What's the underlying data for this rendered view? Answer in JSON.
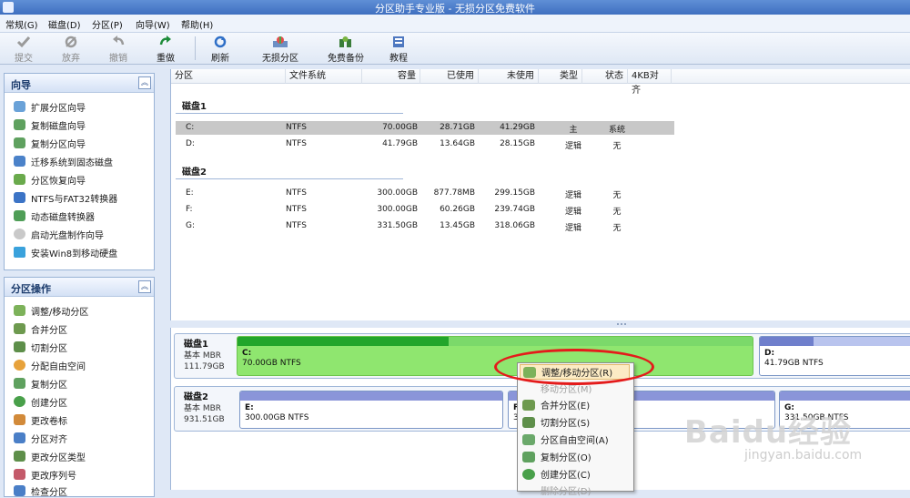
{
  "window": {
    "title": "分区助手专业版 - 无损分区免费软件"
  },
  "menu": [
    "常规(G)",
    "磁盘(D)",
    "分区(P)",
    "向导(W)",
    "帮助(H)"
  ],
  "toolbar": {
    "buttons": [
      {
        "label": "提交",
        "icon": "check-icon",
        "disabled": true
      },
      {
        "label": "放弃",
        "icon": "discard-icon",
        "disabled": true
      },
      {
        "label": "撤销",
        "icon": "undo-icon",
        "disabled": true
      },
      {
        "label": "重做",
        "icon": "redo-icon",
        "disabled": false
      },
      {
        "label": "刷新",
        "icon": "refresh-icon",
        "disabled": false
      },
      {
        "label": "无损分区",
        "icon": "partition-icon",
        "disabled": false
      },
      {
        "label": "免费备份",
        "icon": "backup-icon",
        "disabled": false
      },
      {
        "label": "教程",
        "icon": "tutorial-icon",
        "disabled": false
      }
    ]
  },
  "wizard_panel": {
    "title": "向导",
    "items": [
      "扩展分区向导",
      "复制磁盘向导",
      "复制分区向导",
      "迁移系统到固态磁盘",
      "分区恢复向导",
      "NTFS与FAT32转换器",
      "动态磁盘转换器",
      "启动光盘制作向导",
      "安装Win8到移动硬盘"
    ]
  },
  "ops_panel": {
    "title": "分区操作",
    "items": [
      "调整/移动分区",
      "合并分区",
      "切割分区",
      "分配自由空间",
      "复制分区",
      "创建分区",
      "更改卷标",
      "分区对齐",
      "更改分区类型",
      "更改序列号",
      "检查分区"
    ]
  },
  "list": {
    "columns": [
      "分区",
      "文件系统",
      "容量",
      "已使用",
      "未使用",
      "类型",
      "状态",
      "4KB对齐"
    ],
    "disks": [
      {
        "name": "磁盘1",
        "rows": [
          {
            "part": "C:",
            "fs": "NTFS",
            "cap": "70.00GB",
            "used": "28.71GB",
            "free": "41.29GB",
            "type": "主",
            "status": "系统",
            "selected": true
          },
          {
            "part": "D:",
            "fs": "NTFS",
            "cap": "41.79GB",
            "used": "13.64GB",
            "free": "28.15GB",
            "type": "逻辑",
            "status": "无",
            "selected": false
          }
        ]
      },
      {
        "name": "磁盘2",
        "rows": [
          {
            "part": "E:",
            "fs": "NTFS",
            "cap": "300.00GB",
            "used": "877.78MB",
            "free": "299.15GB",
            "type": "逻辑",
            "status": "无",
            "selected": false
          },
          {
            "part": "F:",
            "fs": "NTFS",
            "cap": "300.00GB",
            "used": "60.26GB",
            "free": "239.74GB",
            "type": "逻辑",
            "status": "无",
            "selected": false
          },
          {
            "part": "G:",
            "fs": "NTFS",
            "cap": "331.50GB",
            "used": "13.45GB",
            "free": "318.06GB",
            "type": "逻辑",
            "status": "无",
            "selected": false
          }
        ]
      }
    ]
  },
  "disk_map": {
    "disk1": {
      "name": "磁盘1",
      "type": "基本 MBR",
      "size": "111.79GB",
      "parts": [
        {
          "letter": "C:",
          "desc": "70.00GB NTFS",
          "used_fraction": 0.41
        },
        {
          "letter": "D:",
          "desc": "41.79GB NTFS",
          "used_fraction": 0.33
        }
      ]
    },
    "disk2": {
      "name": "磁盘2",
      "type": "基本 MBR",
      "size": "931.51GB",
      "parts": [
        {
          "letter": "E:",
          "desc": "300.00GB NTFS"
        },
        {
          "letter": "F",
          "desc": "30"
        },
        {
          "letter": "G:",
          "desc": "331.50GB NTFS"
        }
      ]
    }
  },
  "context_menu": {
    "items": [
      {
        "label": "调整/移动分区(R)",
        "state": "highlighted"
      },
      {
        "label": "移动分区(M)",
        "state": "disabled"
      },
      {
        "label": "合并分区(E)",
        "state": "normal"
      },
      {
        "label": "切割分区(S)",
        "state": "normal"
      },
      {
        "label": "分区自由空间(A)",
        "state": "normal"
      },
      {
        "label": "复制分区(O)",
        "state": "normal"
      },
      {
        "label": "创建分区(C)",
        "state": "normal"
      },
      {
        "label": "删除分区(D)",
        "state": "disabled"
      }
    ]
  },
  "watermark": {
    "logo": "Baidu经验",
    "url": "jingyan.baidu.com"
  },
  "colors": {
    "accent": "#3f6fc0",
    "partition_fill": "#7bd96a",
    "partition_used": "#22a52b",
    "highlight_ring": "#e41b1b"
  }
}
